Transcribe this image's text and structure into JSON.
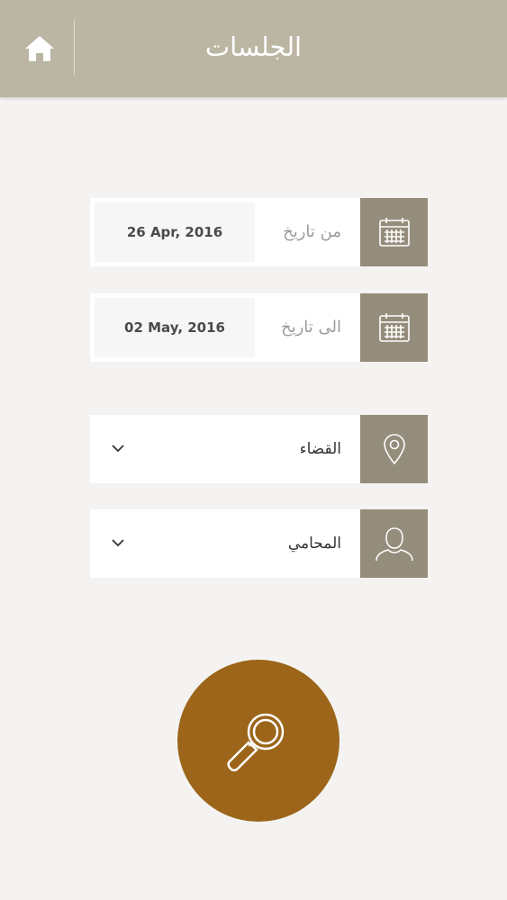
{
  "header": {
    "title": "الجلسات",
    "icon": "home-icon"
  },
  "form": {
    "from_date": {
      "label": "من تاريخ",
      "value": "26 Apr, 2016",
      "icon": "calendar-icon"
    },
    "to_date": {
      "label": "الى تاريخ",
      "value": "02 May, 2016",
      "icon": "calendar-icon"
    },
    "court": {
      "label": "القضاء",
      "icon": "location-pin-icon"
    },
    "lawyer": {
      "label": "المحامي",
      "icon": "user-icon"
    }
  },
  "search": {
    "icon": "search-icon",
    "color": "#9c6519"
  },
  "colors": {
    "header": "#bbb5a3",
    "icon_box": "#958d7c",
    "background": "#f4f3f1"
  }
}
